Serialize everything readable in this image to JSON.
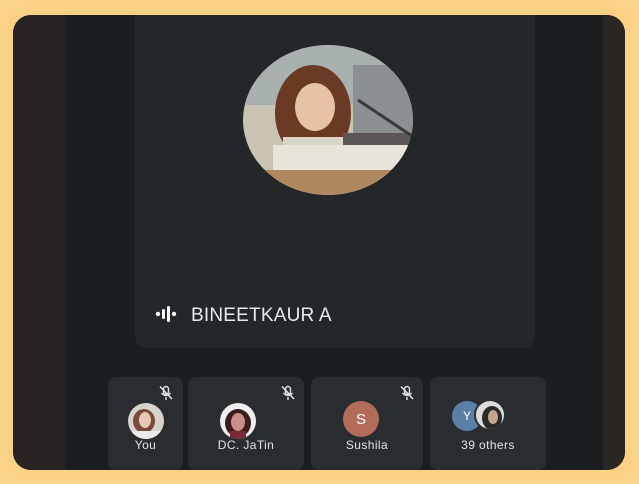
{
  "main_speaker": {
    "name": "BINEETKAUR A",
    "speaking_icon": "audio-wave-icon"
  },
  "participants": [
    {
      "label": "You",
      "avatar": "photo",
      "muted": true
    },
    {
      "label": "DC. JaTin",
      "avatar": "photo",
      "muted": true
    },
    {
      "label": "Sushila",
      "avatar_initial": "S",
      "avatar_color": "#b36b5a",
      "muted": true
    },
    {
      "label": "39 others",
      "avatar_initial": "Y",
      "avatar_color": "#5c7fa8",
      "muted": false
    }
  ],
  "colors": {
    "frame": "#fbd186",
    "background": "#1b1e21",
    "tile": "#2a2d30",
    "text": "#e8eaed"
  }
}
